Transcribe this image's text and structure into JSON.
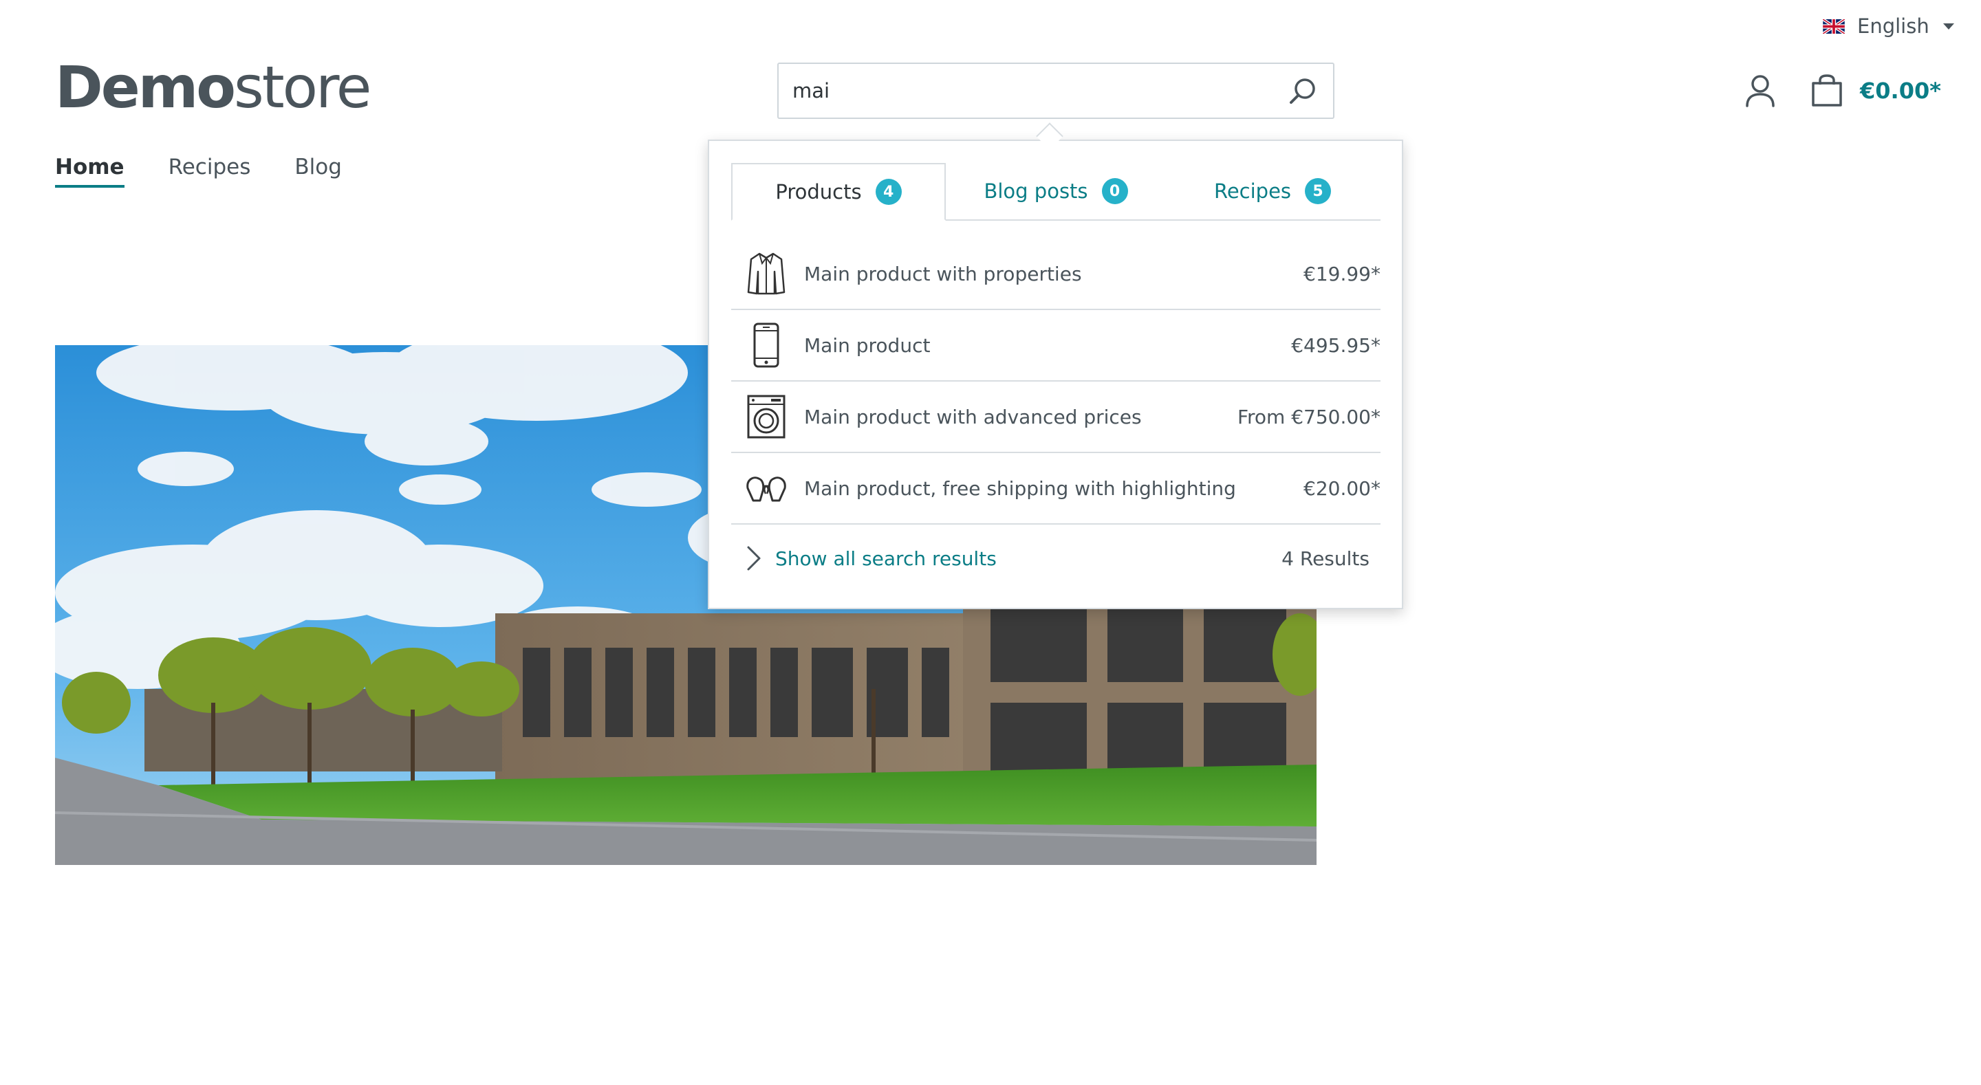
{
  "language": {
    "label": "English",
    "flag_icon": "uk-flag-icon"
  },
  "logo": {
    "bold": "Demo",
    "light": "store"
  },
  "nav": {
    "items": [
      {
        "label": "Home",
        "active": true
      },
      {
        "label": "Recipes",
        "active": false
      },
      {
        "label": "Blog",
        "active": false
      }
    ]
  },
  "search": {
    "value": "mai",
    "button_icon": "search-icon"
  },
  "header": {
    "account_icon": "user-icon",
    "cart_icon": "shopping-bag-icon",
    "cart_total": "€0.00*"
  },
  "dropdown": {
    "tabs": [
      {
        "label": "Products",
        "count": "4",
        "active": true
      },
      {
        "label": "Blog posts",
        "count": "0",
        "active": false
      },
      {
        "label": "Recipes",
        "count": "5",
        "active": false
      }
    ],
    "results": [
      {
        "name": "Main product with properties",
        "price": "€19.99*",
        "icon": "jacket-icon"
      },
      {
        "name": "Main product",
        "price": "€495.95*",
        "icon": "smartphone-icon"
      },
      {
        "name": "Main product with advanced prices",
        "price": "From €750.00*",
        "icon": "washing-machine-icon"
      },
      {
        "name": "Main product, free shipping with highlighting",
        "price": "€20.00*",
        "icon": "boxing-gloves-icon"
      }
    ],
    "show_all_label": "Show all search results",
    "results_count": "4 Results"
  },
  "colors": {
    "accent": "#0b7d86",
    "badge": "#26b1c9",
    "text": "#4a545b"
  }
}
